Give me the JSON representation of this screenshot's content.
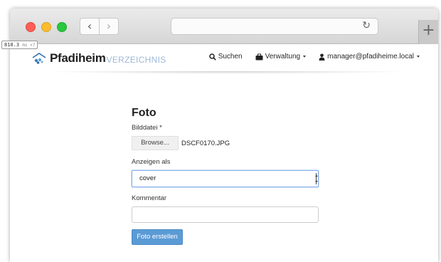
{
  "browser": {
    "back_glyph": "‹",
    "forward_glyph": "›",
    "reload_glyph": "↻",
    "newtab_glyph": "+",
    "perf_value": "818.3",
    "perf_unit": "ms ×7"
  },
  "nav": {
    "brand_bold": "Pfadiheim",
    "brand_light": "VERZEICHNIS",
    "search_label": "Suchen",
    "admin_label": "Verwaltung",
    "user_label": "manager@pfadiheime.local"
  },
  "form": {
    "title": "Foto",
    "file_label": "Bilddatei *",
    "browse_label": "Browse...",
    "file_name": "DSCF0170.JPG",
    "display_label": "Anzeigen als",
    "display_value": "cover",
    "comment_label": "Kommentar",
    "comment_value": "",
    "submit_label": "Foto erstellen"
  },
  "colors": {
    "primary": "#5b9bd5",
    "brand_light": "#9fb7d6",
    "close": "#fc5f57",
    "minimize": "#fdbc2e",
    "zoom": "#29c840"
  }
}
